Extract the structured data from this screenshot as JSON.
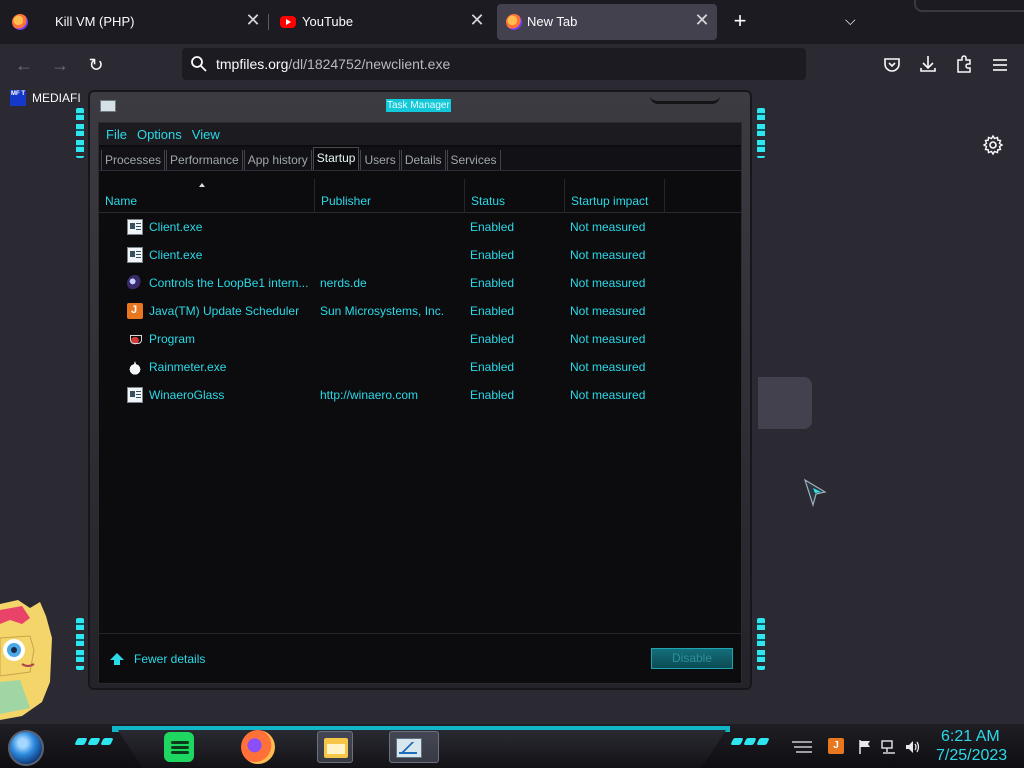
{
  "browser": {
    "tabs": [
      {
        "title": "Kill VM (PHP)",
        "favicon": "firefox-icon",
        "active": false
      },
      {
        "title": "YouTube",
        "favicon": "youtube-icon",
        "active": false
      },
      {
        "title": "New Tab",
        "favicon": "firefox-icon",
        "active": true
      }
    ],
    "close_glyph": "✕",
    "newtab_glyph": "+",
    "tablist_glyph": "⌵",
    "nav": {
      "back_glyph": "←",
      "forward_glyph": "→",
      "reload_glyph": "↻"
    },
    "url": {
      "host": "tmpfiles.org",
      "path": "/dl/1824752/newclient.exe"
    },
    "toolbar_icons": [
      "pocket-icon",
      "download-icon",
      "extensions-icon",
      "menu-icon"
    ],
    "bookmark": {
      "label": "MEDIAFI",
      "icon_text": "MF T"
    }
  },
  "task_manager": {
    "title": "Task Manager",
    "menus": [
      "File",
      "Options",
      "View"
    ],
    "tabs": [
      "Processes",
      "Performance",
      "App history",
      "Startup",
      "Users",
      "Details",
      "Services"
    ],
    "active_tab": "Startup",
    "columns": [
      "Name",
      "Publisher",
      "Status",
      "Startup impact"
    ],
    "sorted_by": "Name",
    "rows": [
      {
        "icon": "exe-icon",
        "name": "Client.exe",
        "publisher": "",
        "status": "Enabled",
        "impact": "Not measured"
      },
      {
        "icon": "exe-icon",
        "name": "Client.exe",
        "publisher": "",
        "status": "Enabled",
        "impact": "Not measured"
      },
      {
        "icon": "loopbe-icon",
        "name": "Controls the LoopBe1 intern...",
        "publisher": "nerds.de",
        "status": "Enabled",
        "impact": "Not measured"
      },
      {
        "icon": "java-icon",
        "name": "Java(TM) Update Scheduler",
        "publisher": "Sun Microsystems, Inc.",
        "status": "Enabled",
        "impact": "Not measured"
      },
      {
        "icon": "program-icon",
        "name": "Program",
        "publisher": "",
        "status": "Enabled",
        "impact": "Not measured"
      },
      {
        "icon": "rainmeter-icon",
        "name": "Rainmeter.exe",
        "publisher": "",
        "status": "Enabled",
        "impact": "Not measured"
      },
      {
        "icon": "exe-icon",
        "name": "WinaeroGlass",
        "publisher": "http://winaero.com",
        "status": "Enabled",
        "impact": "Not measured"
      }
    ],
    "footer": {
      "fewer_details": "Fewer details",
      "disable_button": "Disable"
    }
  },
  "taskbar": {
    "apps": [
      {
        "name": "spotify-icon",
        "running": false
      },
      {
        "name": "firefox-icon",
        "running": false
      },
      {
        "name": "file-explorer-icon",
        "running": true
      },
      {
        "name": "task-manager-icon",
        "running": true
      }
    ],
    "tray_icons": [
      "java-update-icon",
      "action-center-flag-icon",
      "network-icon",
      "volume-icon"
    ],
    "clock": {
      "time": "6:21 AM",
      "date": "7/25/2023"
    }
  },
  "colors": {
    "accent": "#2bd9e8",
    "window_bg": "#0c0c0e",
    "browser_bg": "#2b2a33"
  }
}
